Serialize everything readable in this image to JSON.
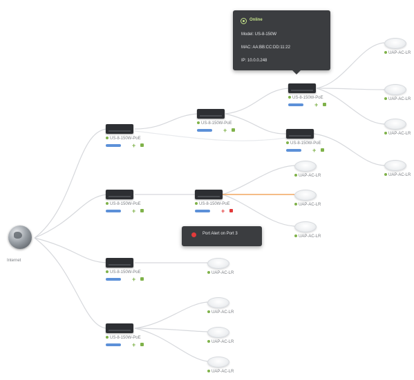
{
  "colors": {
    "link": "#d6d8dc",
    "alert_link": "#f2a55f",
    "bar": "#5c90d8",
    "ok": "#7fb24a",
    "alert": "#e23b3b",
    "tooltip_bg": "#3b3d40"
  },
  "internet": {
    "label": "Internet",
    "icon": "globe-icon"
  },
  "device_label_switch": "US-8-150W-PoE",
  "device_label_ap": "UAP-AC-LR",
  "tooltip": {
    "status": "Online",
    "model": "Model: US-8-150W",
    "mac": "MAC: AA:BB:CC:DD:11:22",
    "ip": "IP: 10.0.0.248"
  },
  "alert_tooltip": {
    "text": "Port Alert on Port 3",
    "icon": "alert-icon"
  }
}
